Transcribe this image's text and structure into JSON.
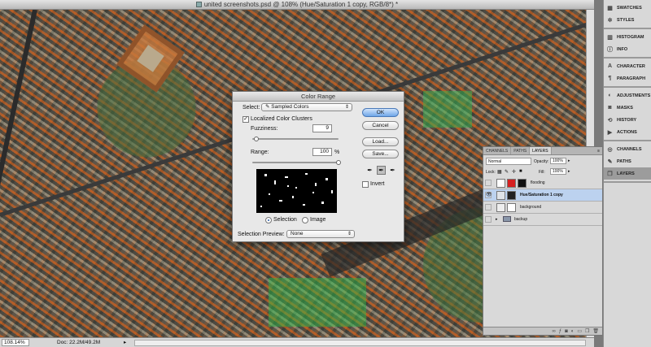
{
  "document": {
    "title": "united screenshots.psd @ 108% (Hue/Saturation 1 copy, RGB/8*) *",
    "zoom": "108.14%",
    "doc_size": "Doc: 22.2M/49.2M"
  },
  "dock": {
    "groups": [
      {
        "items": [
          {
            "icon": "swatches-icon",
            "label": "SWATCHES"
          },
          {
            "icon": "styles-icon",
            "label": "STYLES"
          }
        ]
      },
      {
        "items": [
          {
            "icon": "histogram-icon",
            "label": "HISTOGRAM"
          },
          {
            "icon": "info-icon",
            "label": "INFO"
          }
        ]
      },
      {
        "items": [
          {
            "icon": "character-icon",
            "label": "CHARACTER"
          },
          {
            "icon": "paragraph-icon",
            "label": "PARAGRAPH"
          }
        ]
      },
      {
        "items": [
          {
            "icon": "adjustments-icon",
            "label": "ADJUSTMENTS"
          },
          {
            "icon": "masks-icon",
            "label": "MASKS"
          },
          {
            "icon": "history-icon",
            "label": "HISTORY"
          },
          {
            "icon": "actions-icon",
            "label": "ACTIONS"
          }
        ]
      },
      {
        "items": [
          {
            "icon": "channels-icon",
            "label": "CHANNELS"
          },
          {
            "icon": "paths-icon",
            "label": "PATHS"
          },
          {
            "icon": "layers-icon",
            "label": "LAYERS",
            "active": true
          }
        ]
      }
    ]
  },
  "layers_panel": {
    "tabs": [
      "CHANNELS",
      "PATHS",
      "LAYERS"
    ],
    "active_tab": "LAYERS",
    "blend_mode": "Normal",
    "opacity_label": "Opacity:",
    "opacity": "100%",
    "lock_label": "Lock:",
    "fill_label": "Fill:",
    "fill": "100%",
    "layers": [
      {
        "name": "flooding",
        "visible": false,
        "selected": false,
        "type": "adjustment"
      },
      {
        "name": "Hue/Saturation 1 copy",
        "visible": true,
        "selected": true,
        "type": "adjustment"
      },
      {
        "name": "background",
        "visible": false,
        "selected": false,
        "type": "pixel"
      },
      {
        "name": "backup",
        "visible": false,
        "selected": false,
        "type": "group"
      }
    ]
  },
  "color_range": {
    "title": "Color Range",
    "select_label": "Select:",
    "select_value": "Sampled Colors",
    "localized_label": "Localized Color Clusters",
    "localized_checked": true,
    "fuzziness_label": "Fuzziness:",
    "fuzziness": "9",
    "fuzziness_fraction": 0.05,
    "range_label": "Range:",
    "range": "100",
    "range_unit": "%",
    "range_fraction": 1.0,
    "view_selection": "Selection",
    "view_image": "Image",
    "view_mode": "selection",
    "preview_label": "Selection Preview:",
    "preview_value": "None",
    "buttons": {
      "ok": "OK",
      "cancel": "Cancel",
      "load": "Load...",
      "save": "Save..."
    },
    "invert_label": "Invert",
    "invert_checked": false
  },
  "colors": {
    "selection_blue": "#bcd2ef",
    "default_button": "#6fa6e8",
    "flooding_swatch": "#d62020"
  }
}
